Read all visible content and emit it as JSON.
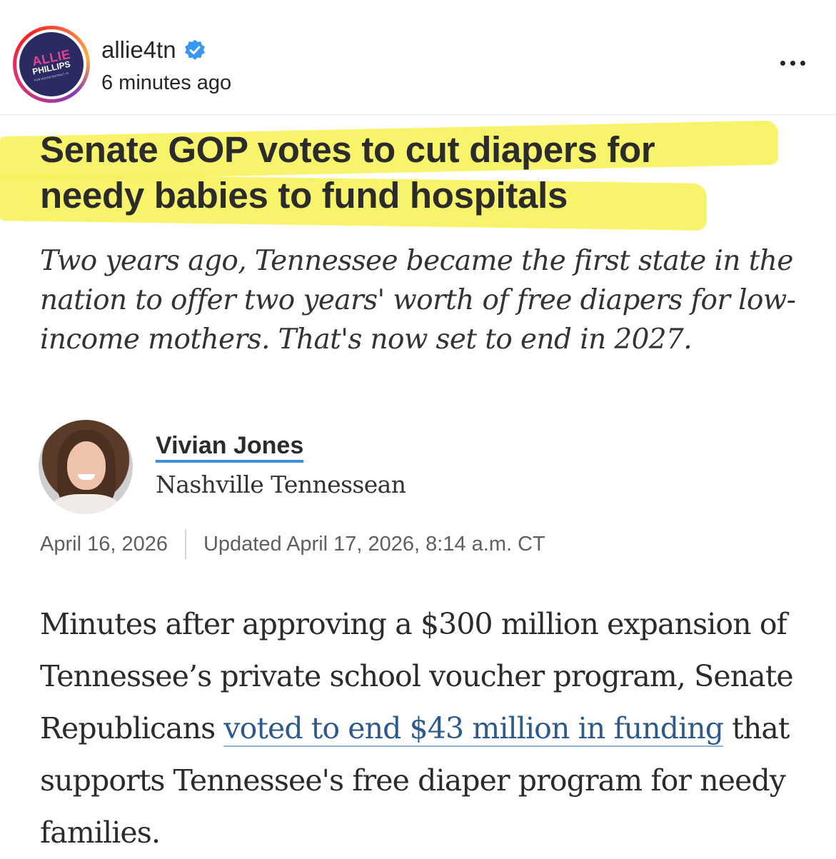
{
  "post": {
    "logo": {
      "line1": "ALLIE",
      "line2": "PHILLIPS",
      "line3": "FOR HOUSE DISTRICT 75"
    },
    "username": "allie4tn",
    "verified_icon": "verified-badge-icon",
    "timestamp": "6 minutes ago",
    "more_icon": "more-options-icon"
  },
  "article": {
    "headline_line1": "Senate GOP votes to cut diapers for",
    "headline_line2": "needy babies to fund hospitals",
    "subhead": "Two years ago, Tennessee became the first state in the nation to offer two years' worth of free diapers for low-income mothers. That's now set to end in 2027.",
    "author": {
      "name": "Vivian Jones",
      "outlet": "Nashville Tennessean"
    },
    "published": "April 16, 2026",
    "updated": "Updated April 17, 2026, 8:14 a.m. CT",
    "body": {
      "before_link": "Minutes after approving a $300 million expansion of Tennessee’s private school voucher program, Senate Republicans ",
      "link_text": "voted to end $43 million in funding",
      "after_link": " that supports Tennessee's free diaper program for needy families."
    }
  },
  "colors": {
    "highlight": "#f6f25e",
    "author_underline": "#3c8fde",
    "link": "#2d5a8c",
    "verified": "#3897f0",
    "logo_bg": "#2b2a63",
    "logo_accent": "#e8448f"
  }
}
